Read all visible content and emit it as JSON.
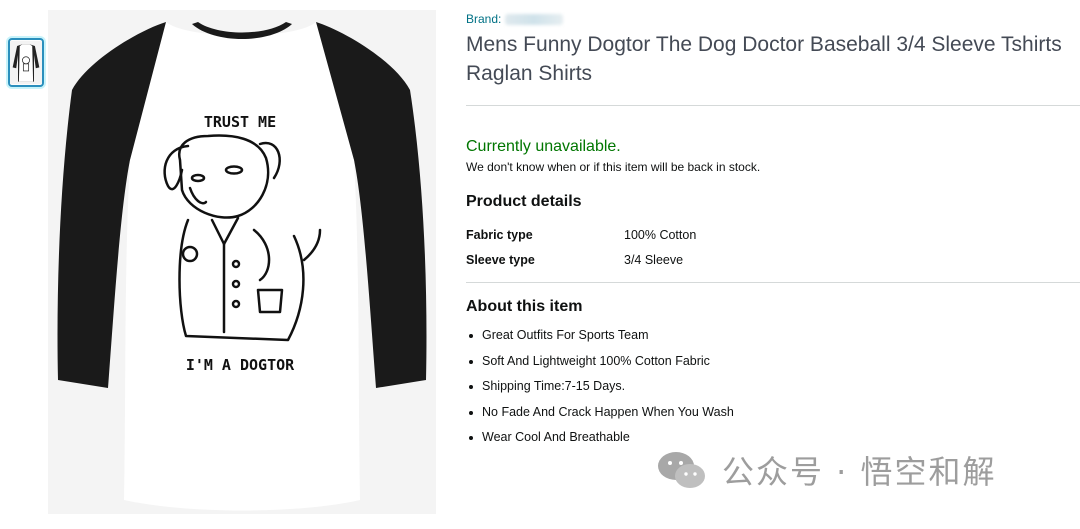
{
  "product": {
    "brand_label": "Brand:",
    "title": "Mens Funny Dogtor The Dog Doctor Baseball 3/4 Sleeve Tshirts Raglan Shirts",
    "image": {
      "top_text": "TRUST ME",
      "bottom_text": "I'M A DOGTOR"
    }
  },
  "availability": {
    "status": "Currently unavailable.",
    "note": "We don't know when or if this item will be back in stock."
  },
  "details": {
    "heading": "Product details",
    "rows": [
      {
        "label": "Fabric type",
        "value": "100% Cotton"
      },
      {
        "label": "Sleeve type",
        "value": "3/4 Sleeve"
      }
    ]
  },
  "about": {
    "heading": "About this item",
    "bullets": [
      "Great Outfits For Sports Team",
      "Soft And Lightweight 100% Cotton Fabric",
      "Shipping Time:7-15 Days.",
      "No Fade And Crack Happen When You Wash",
      "Wear Cool And Breathable"
    ]
  },
  "watermark": {
    "text": "公众号 · 悟空和解"
  },
  "colors": {
    "link": "#007185",
    "available": "#007600",
    "text": "#0f1111"
  }
}
